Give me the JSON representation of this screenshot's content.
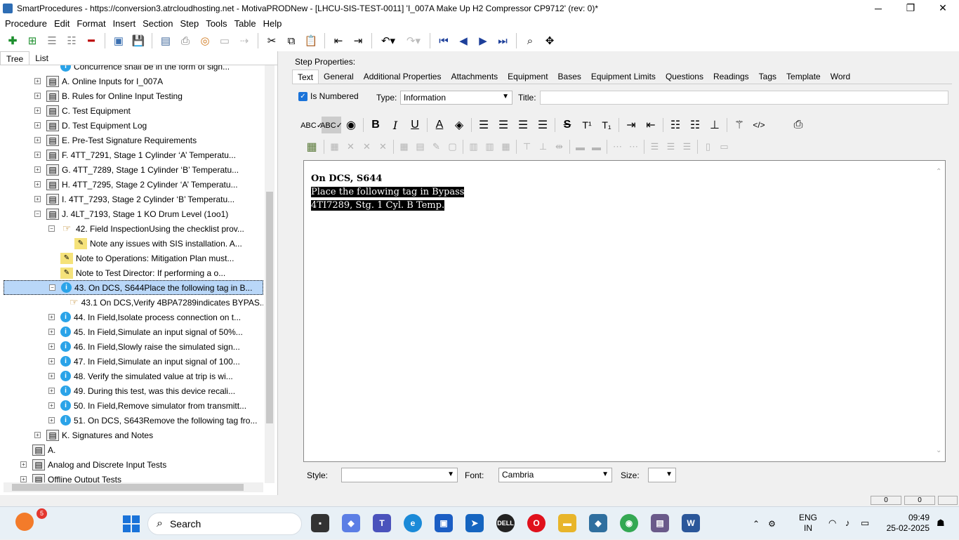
{
  "window": {
    "title": "SmartProcedures - https://conversion3.atrcloudhosting.net - MotivaPRODNew - [LHCU-SIS-TEST-0011] 'I_007A Make Up H2 Compressor CP9712' (rev: 0)*",
    "minimize": "─",
    "maximize": "❐",
    "close": "✕"
  },
  "menu": [
    "Procedure",
    "Edit",
    "Format",
    "Insert",
    "Section",
    "Step",
    "Tools",
    "Table",
    "Help"
  ],
  "tree_tabs": [
    "Tree",
    "List"
  ],
  "tree": [
    {
      "label": "Concurrence shall be in the form of sign...",
      "icon": "info-icon",
      "expander": "",
      "indent": 2
    },
    {
      "label": "A. Online Inputs for I_007A",
      "icon": "section-icon",
      "expander": "+",
      "indent": 1
    },
    {
      "label": "B. Rules for Online Input Testing",
      "icon": "section-icon",
      "expander": "+",
      "indent": 1
    },
    {
      "label": "C. Test Equipment",
      "icon": "section-icon",
      "expander": "+",
      "indent": 1
    },
    {
      "label": "D. Test Equipment Log",
      "icon": "section-icon",
      "expander": "+",
      "indent": 1
    },
    {
      "label": "E. Pre-Test Signature Requirements",
      "icon": "section-icon",
      "expander": "+",
      "indent": 1
    },
    {
      "label": "F. 4TT_7291, Stage 1 Cylinder ‘A’ Temperatu...",
      "icon": "section-icon",
      "expander": "+",
      "indent": 1
    },
    {
      "label": "G. 4TT_7289, Stage 1 Cylinder ‘B’ Temperatu...",
      "icon": "section-icon",
      "expander": "+",
      "indent": 1
    },
    {
      "label": "H. 4TT_7295, Stage 2 Cylinder ‘A’ Temperatu...",
      "icon": "section-icon",
      "expander": "+",
      "indent": 1
    },
    {
      "label": "I. 4TT_7293, Stage 2 Cylinder ‘B’ Temperatu...",
      "icon": "section-icon",
      "expander": "+",
      "indent": 1
    },
    {
      "label": "J. 4LT_7193, Stage 1 KO Drum Level (1oo1)",
      "icon": "section-icon",
      "expander": "−",
      "indent": 1
    },
    {
      "label": "42. Field InspectionUsing the checklist prov...",
      "icon": "hand-icon",
      "expander": "−",
      "indent": 2
    },
    {
      "label": "Note any issues with SIS installation. A...",
      "icon": "note-icon",
      "expander": "",
      "indent": 3
    },
    {
      "label": "Note to Operations: Mitigation Plan must...",
      "icon": "note-icon",
      "expander": "",
      "indent": 2
    },
    {
      "label": "Note to Test Director: If performing a o...",
      "icon": "note-icon",
      "expander": "",
      "indent": 2
    },
    {
      "label": "43. On DCS, S644Place the following tag in B...",
      "icon": "info-icon",
      "expander": "−",
      "indent": 2,
      "selected": true
    },
    {
      "label": "43.1  On DCS,Verify  4BPA7289indicates  BYPAS...",
      "icon": "hand-icon",
      "expander": "",
      "indent": 3
    },
    {
      "label": "44. In Field,Isolate process connection on t...",
      "icon": "info-icon",
      "expander": "+",
      "indent": 2
    },
    {
      "label": "45. In Field,Simulate an input signal of 50%...",
      "icon": "info-icon",
      "expander": "+",
      "indent": 2
    },
    {
      "label": "46. In Field,Slowly raise the simulated sign...",
      "icon": "info-icon",
      "expander": "+",
      "indent": 2
    },
    {
      "label": "47. In Field,Simulate an input signal of 100...",
      "icon": "info-icon",
      "expander": "+",
      "indent": 2
    },
    {
      "label": "48. Verify the simulated value at trip is wi...",
      "icon": "info-icon",
      "expander": "+",
      "indent": 2
    },
    {
      "label": "49. During this test, was this device recali...",
      "icon": "info-icon",
      "expander": "+",
      "indent": 2
    },
    {
      "label": "50. In Field,Remove simulator from transmitt...",
      "icon": "info-icon",
      "expander": "+",
      "indent": 2
    },
    {
      "label": "51. On DCS, S643Remove the following tag fro...",
      "icon": "info-icon",
      "expander": "+",
      "indent": 2
    },
    {
      "label": "K. Signatures and Notes",
      "icon": "section-icon",
      "expander": "+",
      "indent": 1
    },
    {
      "label": "A.",
      "icon": "section-icon",
      "expander": "",
      "indent": 0
    },
    {
      "label": "Analog and Discrete Input Tests",
      "icon": "section-icon",
      "expander": "+",
      "indent": 0
    },
    {
      "label": "Offline Output Tests",
      "icon": "section-icon",
      "expander": "+",
      "indent": 0
    }
  ],
  "step_properties": {
    "heading": "Step Properties:",
    "tabs": [
      "Text",
      "General",
      "Additional Properties",
      "Attachments",
      "Equipment",
      "Bases",
      "Equipment Limits",
      "Questions",
      "Readings",
      "Tags",
      "Template",
      "Word"
    ],
    "is_numbered_label": "Is Numbered",
    "type_label": "Type:",
    "type_value": "Information",
    "title_label": "Title:",
    "title_value": ""
  },
  "editor": {
    "line1": "On DCS, S644",
    "line2": "Place the following tag in Bypass",
    "line3": "4TI7289, Stg. 1 Cyl. B Temp."
  },
  "bottom": {
    "style_label": "Style:",
    "style_value": "",
    "font_label": "Font:",
    "font_value": "Cambria",
    "size_label": "Size:",
    "size_value": ""
  },
  "status": {
    "cell1": "0",
    "cell2": "0"
  },
  "taskbar": {
    "weather_badge": "5",
    "search_placeholder": "Search",
    "lang1": "ENG",
    "lang2": "IN",
    "time": "09:49",
    "date": "25-02-2025"
  }
}
